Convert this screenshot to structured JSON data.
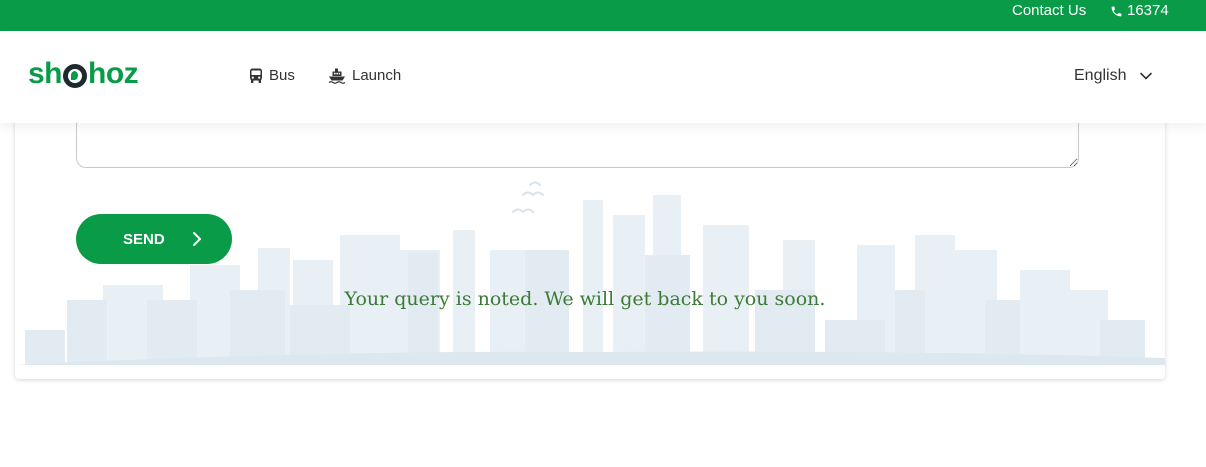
{
  "topbar": {
    "contact_label": "Contact Us",
    "phone": "16374",
    "phone_icon": "phone-icon",
    "background": "#0a9b48"
  },
  "navbar": {
    "logo_text_start": "sh",
    "logo_text_end": "hoz",
    "items": [
      {
        "label": "Bus",
        "icon": "bus-icon"
      },
      {
        "label": "Launch",
        "icon": "ship-icon"
      }
    ],
    "language": "English",
    "language_icon": "chevron-down-icon"
  },
  "form": {
    "message_value": "",
    "send_label": "SEND",
    "send_icon": "chevron-right-icon",
    "success_message": "Your query is noted. We will get back to you soon."
  },
  "colors": {
    "brand_green": "#0a9b48",
    "success_text": "#3c7a36",
    "skyline": "#e6eef3"
  }
}
